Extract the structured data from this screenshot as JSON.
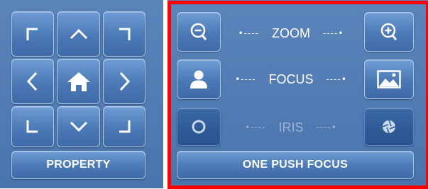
{
  "ptz": {
    "buttons": [
      "up-left",
      "up",
      "up-right",
      "left",
      "home",
      "right",
      "down-left",
      "down",
      "down-right"
    ],
    "property_label": "PROPERTY"
  },
  "lens": {
    "zoom_label": "ZOOM",
    "focus_label": "FOCUS",
    "iris_label": "IRIS",
    "arrow_left": "•----",
    "arrow_right": "----•",
    "one_push_label": "ONE PUSH FOCUS"
  },
  "colors": {
    "highlight_border": "#ff0000",
    "panel_bg": "#4a74ac"
  }
}
